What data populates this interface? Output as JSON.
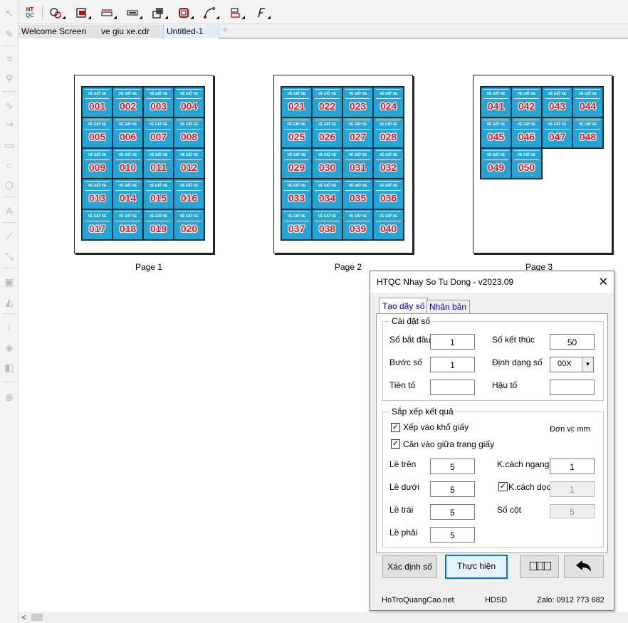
{
  "tabs": [
    {
      "label": "Welcome Screen"
    },
    {
      "label": "ve giu xe.cdr"
    },
    {
      "label": "Untitled-1"
    }
  ],
  "toolbar": {
    "htqc_top": "HT",
    "htqc_bottom": "QC"
  },
  "pages": [
    {
      "label": "Page 1",
      "tiles": [
        "001",
        "002",
        "003",
        "004",
        "005",
        "006",
        "007",
        "008",
        "009",
        "010",
        "011",
        "012",
        "013",
        "014",
        "015",
        "016",
        "017",
        "018",
        "019",
        "020"
      ]
    },
    {
      "label": "Page 2",
      "tiles": [
        "021",
        "022",
        "023",
        "024",
        "025",
        "026",
        "027",
        "028",
        "029",
        "030",
        "031",
        "032",
        "033",
        "034",
        "035",
        "036",
        "037",
        "038",
        "039",
        "040"
      ]
    },
    {
      "label": "Page 3",
      "tiles": [
        "041",
        "042",
        "043",
        "044",
        "045",
        "046",
        "047",
        "048",
        "049",
        "050"
      ]
    }
  ],
  "tile_header": "VÉ GIỮ XE",
  "dialog": {
    "title": "HTQC Nhay So Tu Dong - v2023.09",
    "close_symbol": "✕",
    "tab_create": "Tạo dãy số",
    "tab_clone": "Nhân bản",
    "group_settings": "Cài đặt số",
    "start_label": "Số bắt đầu",
    "start_value": "1",
    "end_label": "Số kết thúc",
    "end_value": "50",
    "step_label": "Bước số",
    "step_value": "1",
    "format_label": "Định dạng số",
    "format_value": "00X",
    "prefix_label": "Tiền tố",
    "prefix_value": "",
    "suffix_label": "Hậu tố",
    "suffix_value": "",
    "group_arrange": "Sắp xếp kết quả",
    "fit_paper_label": "Xếp vào khổ giấy",
    "fit_paper_checked": true,
    "center_label": "Căn vào giữa trang giấy",
    "center_checked": true,
    "unit_label": "Đơn vị: mm",
    "top_label": "Lề trên",
    "top_value": "5",
    "bottom_label": "Lề dưới",
    "bottom_value": "5",
    "left_label": "Lề trái",
    "left_value": "5",
    "right_label": "Lề phải",
    "right_value": "5",
    "hgap_label": "K.cách ngang",
    "hgap_value": "1",
    "vgap_label": "K.cách dọc",
    "vgap_checked": true,
    "vgap_value": "1",
    "cols_label": "Số cột",
    "cols_value": "5",
    "btn_identify": "Xác định số",
    "btn_execute": "Thực hiện",
    "btn_boxes": "□□□",
    "btn_undo_icon": "undo-arrow",
    "footer_site": "HoTroQuangCao.net",
    "footer_help": "HDSD",
    "footer_zalo": "Zalo: 0912 773 682"
  }
}
